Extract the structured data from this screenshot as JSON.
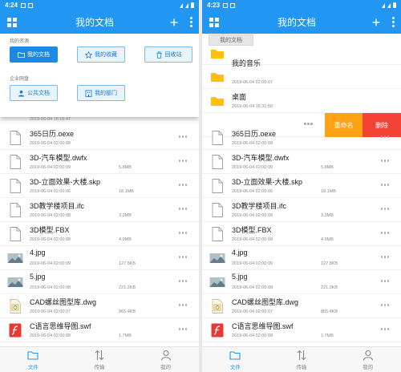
{
  "left": {
    "status": {
      "time": "4:24"
    },
    "title": "我的文档",
    "menu": {
      "section_personal": "我的资源",
      "my_docs": "我的文档",
      "my_favs": "我的收藏",
      "recycle": "回收站",
      "section_enterprise": "企业网盘",
      "public_docs": "公共文档",
      "my_dept": "我的部门",
      "partial_date": "2019-06-04 15:16:47"
    },
    "files": [
      {
        "name": "365日历.oexe",
        "date": "2019-06-04 02:00:08",
        "size": "",
        "icon": "doc-icon"
      },
      {
        "name": "3D-汽车模型.dwfx",
        "date": "2019-06-04 02:00:09",
        "size": "5.8MB",
        "icon": "doc-icon"
      },
      {
        "name": "3D-立面效果-大楼.skp",
        "date": "2019-06-04 02:00:06",
        "size": "18.1MB",
        "icon": "doc-icon"
      },
      {
        "name": "3D教学楼项目.ifc",
        "date": "2019-06-04 02:00:08",
        "size": "3.3MB",
        "icon": "doc-icon"
      },
      {
        "name": "3D模型.FBX",
        "date": "2019-06-04 02:00:08",
        "size": "4.9MB",
        "icon": "doc-icon"
      },
      {
        "name": "4.jpg",
        "date": "2019-06-04 02:00:09",
        "size": "127.8KB",
        "icon": "image-thumbnail-icon"
      },
      {
        "name": "5.jpg",
        "date": "2019-06-04 02:00:08",
        "size": "221.2KB",
        "icon": "image-thumbnail-icon"
      },
      {
        "name": "CAD螺丝图型库.dwg",
        "date": "2019-06-04 02:00:07",
        "size": "865.4KB",
        "icon": "cad-file-icon"
      },
      {
        "name": "C语言思维导图.swf",
        "date": "2019-06-04 02:00:08",
        "size": "1.7MB",
        "icon": "flash-file-icon"
      }
    ],
    "nav": {
      "files": "文件",
      "transfer": "传输",
      "me": "我的"
    }
  },
  "right": {
    "status": {
      "time": "4:23"
    },
    "title": "我的文档",
    "ghost_label": "我的文档",
    "folders": [
      {
        "name": "我的音乐",
        "date": "2019-06-04 02:00:07"
      },
      {
        "name": "桌面",
        "date": "2019-06-04 15:31:50"
      }
    ],
    "swipe": {
      "rename": "重命名",
      "delete": "删除"
    },
    "files": [
      {
        "name": "365日历.oexe",
        "date": "2019-06-04 02:00:08",
        "size": "",
        "icon": "doc-icon"
      },
      {
        "name": "3D-汽车模型.dwfx",
        "date": "2019-06-04 02:00:09",
        "size": "5.8MB",
        "icon": "doc-icon"
      },
      {
        "name": "3D-立面效果-大楼.skp",
        "date": "2019-06-04 02:00:06",
        "size": "18.1MB",
        "icon": "doc-icon"
      },
      {
        "name": "3D教学楼项目.ifc",
        "date": "2019-06-04 02:00:08",
        "size": "3.3MB",
        "icon": "doc-icon"
      },
      {
        "name": "3D模型.FBX",
        "date": "2019-06-04 02:00:08",
        "size": "4.9MB",
        "icon": "doc-icon"
      },
      {
        "name": "4.jpg",
        "date": "2019-06-04 02:00:09",
        "size": "127.8KB",
        "icon": "image-thumbnail-icon"
      },
      {
        "name": "5.jpg",
        "date": "2019-06-04 02:00:08",
        "size": "221.2KB",
        "icon": "image-thumbnail-icon"
      },
      {
        "name": "CAD螺丝图型库.dwg",
        "date": "2019-06-04 02:00:07",
        "size": "865.4KB",
        "icon": "cad-file-icon"
      },
      {
        "name": "C语言思维导图.swf",
        "date": "2019-06-04 02:00:08",
        "size": "1.7MB",
        "icon": "flash-file-icon"
      }
    ],
    "nav": {
      "files": "文件",
      "transfer": "传输",
      "me": "我的"
    }
  },
  "colors": {
    "accent": "#2196f3",
    "rename": "#ffa115",
    "delete": "#f44336",
    "folder": "#ffc107"
  }
}
